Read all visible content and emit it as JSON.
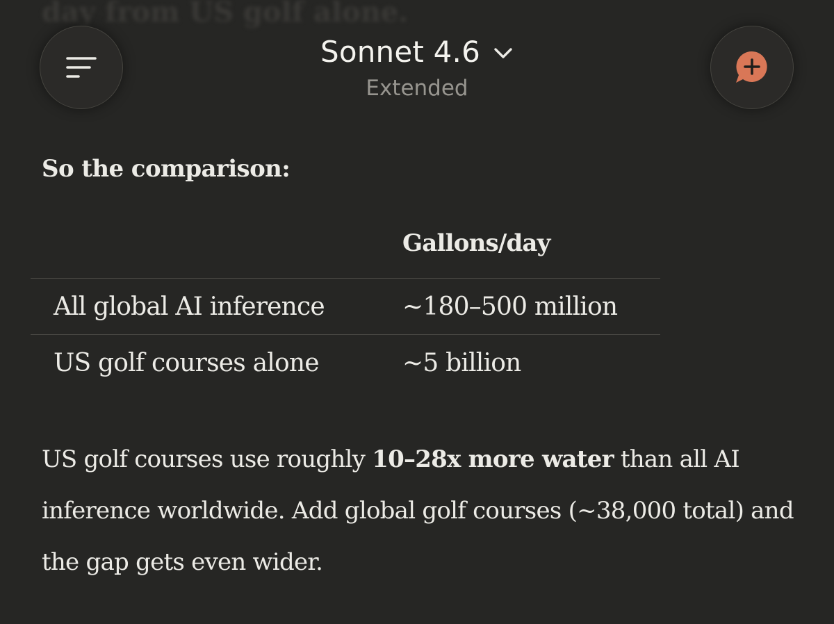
{
  "top_fade_text": "day from US golf alone.",
  "header": {
    "model_name": "Sonnet 4.6",
    "model_mode": "Extended",
    "menu_icon": "hamburger-menu-icon",
    "new_chat_icon": "chat-plus-icon",
    "accent_color": "#d97757"
  },
  "content": {
    "heading": "So the comparison:",
    "table": {
      "columns": [
        "",
        "Gallons/day"
      ],
      "rows": [
        [
          "All global AI inference",
          "~180–500 million"
        ],
        [
          "US golf courses alone",
          "~5 billion"
        ]
      ]
    },
    "paragraph": {
      "before": "US golf courses use roughly ",
      "bold": "10–28x more water",
      "after": " than all AI inference worldwide. Add global golf courses (~38,000 total) and the gap gets even wider."
    }
  }
}
